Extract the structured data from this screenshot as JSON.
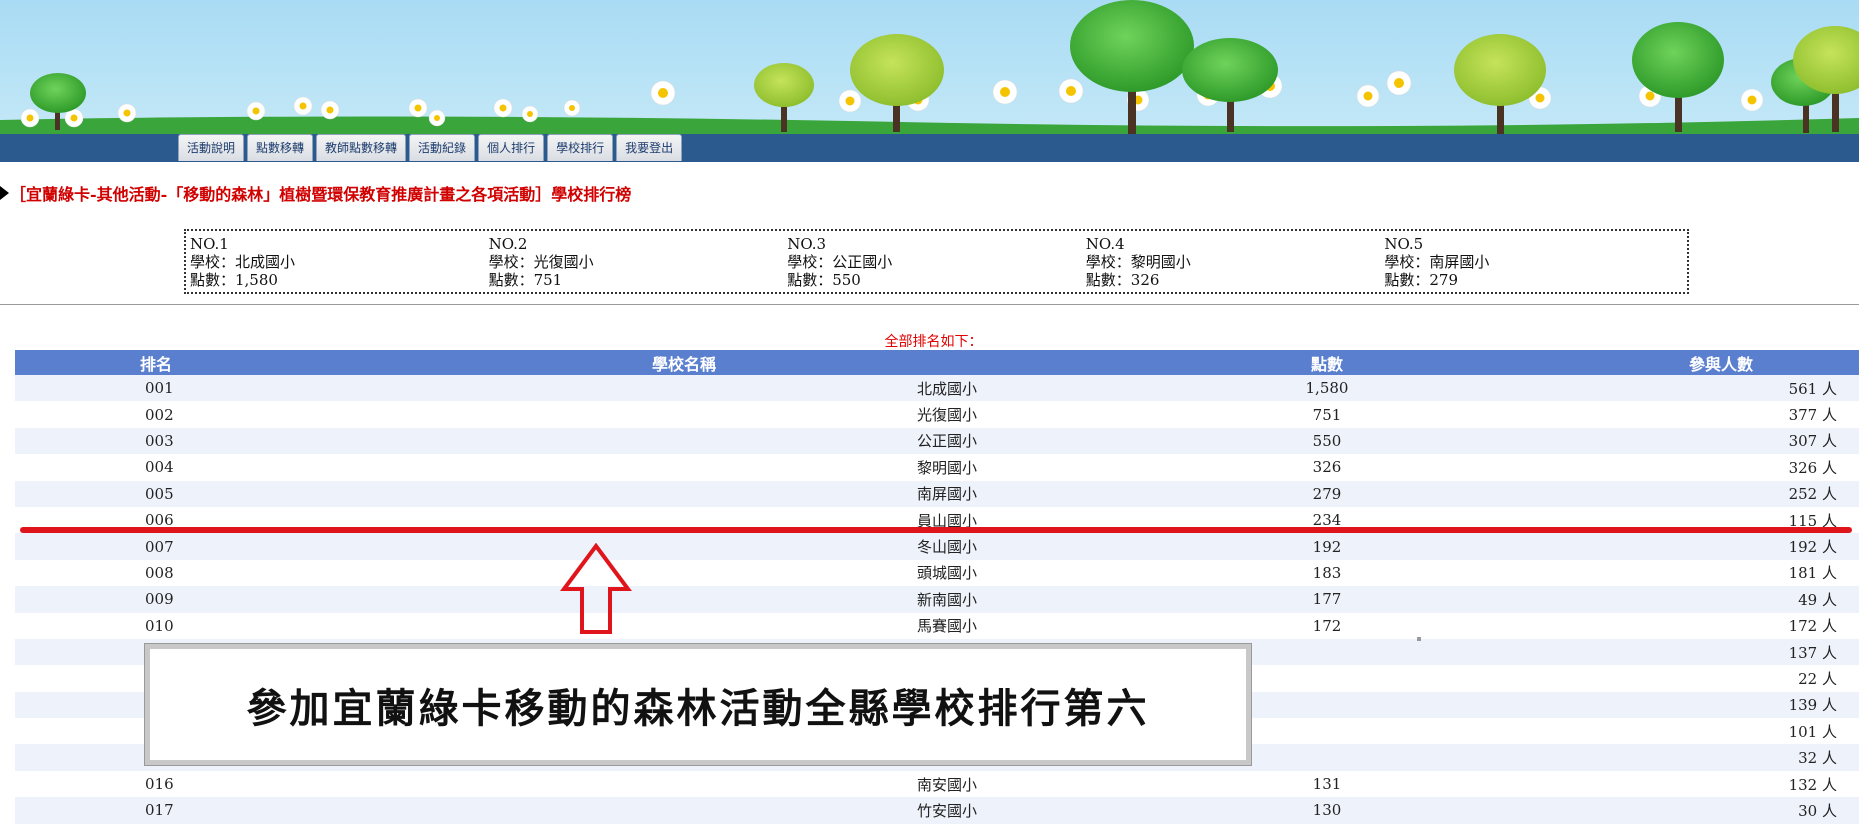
{
  "nav": {
    "tabs": [
      "活動說明",
      "點數移轉",
      "教師點數移轉",
      "活動紀錄",
      "個人排行",
      "學校排行",
      "我要登出"
    ]
  },
  "page_title": "［宜蘭綠卡-其他活動-「移動的森林」植樹暨環保教育推廣計畫之各項活動］學校排行榜",
  "top5": [
    {
      "no": "NO.1",
      "school": "學校：北成國小",
      "points": "點數：1,580"
    },
    {
      "no": "NO.2",
      "school": "學校：光復國小",
      "points": "點數：751"
    },
    {
      "no": "NO.3",
      "school": "學校：公正國小",
      "points": "點數：550"
    },
    {
      "no": "NO.4",
      "school": "學校：黎明國小",
      "points": "點數：326"
    },
    {
      "no": "NO.5",
      "school": "學校：南屏國小",
      "points": "點數：279"
    }
  ],
  "all_rank_label": "全部排名如下：",
  "table": {
    "headers": [
      "排名",
      "學校名稱",
      "點數",
      "參與人數"
    ],
    "rows": [
      [
        "001",
        "北成國小",
        "1,580",
        "561 人"
      ],
      [
        "002",
        "光復國小",
        "751",
        "377 人"
      ],
      [
        "003",
        "公正國小",
        "550",
        "307 人"
      ],
      [
        "004",
        "黎明國小",
        "326",
        "326 人"
      ],
      [
        "005",
        "南屏國小",
        "279",
        "252 人"
      ],
      [
        "006",
        "員山國小",
        "234",
        "115 人"
      ],
      [
        "007",
        "冬山國小",
        "192",
        "192 人"
      ],
      [
        "008",
        "頭城國小",
        "183",
        "181 人"
      ],
      [
        "009",
        "新南國小",
        "177",
        "49 人"
      ],
      [
        "010",
        "馬賽國小",
        "172",
        "172 人"
      ],
      [
        "",
        "",
        "",
        "137 人"
      ],
      [
        "",
        "",
        "",
        "22 人"
      ],
      [
        "",
        "",
        "",
        "139 人"
      ],
      [
        "",
        "",
        "",
        "101 人"
      ],
      [
        "",
        "",
        "",
        "32 人"
      ],
      [
        "016",
        "南安國小",
        "131",
        "132 人"
      ],
      [
        "017",
        "竹安國小",
        "130",
        "30 人"
      ]
    ]
  },
  "caption": "參加宜蘭綠卡移動的森林活動全縣學校排行第六",
  "colors": {
    "title_red": "#d10000",
    "table_header": "#5b7fcf",
    "annotation_red": "#e0151b",
    "nav_bar": "#2b5a8e",
    "sky": "#b9e2f6"
  }
}
